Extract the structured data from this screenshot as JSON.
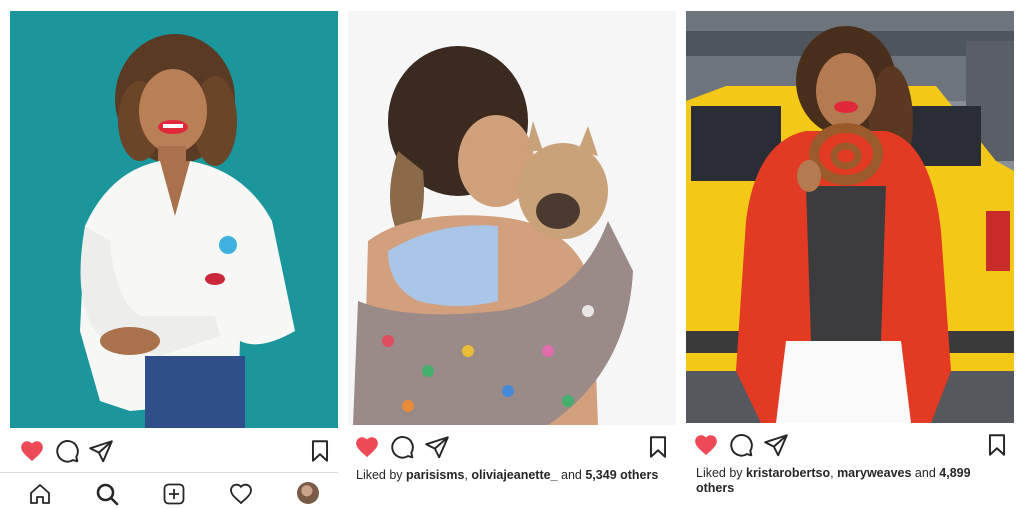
{
  "posts": [
    {
      "id_label": "left",
      "liked_by_label": "",
      "liked_users": [],
      "and_label": "",
      "count": "",
      "others_label": ""
    },
    {
      "id_label": "middle",
      "liked_by_label": "Liked by",
      "liked_users": [
        "parisisms",
        "oliviajeanette_"
      ],
      "and_label": "and",
      "count": "5,349",
      "others_label": "others"
    },
    {
      "id_label": "right",
      "liked_by_label": "Liked by",
      "liked_users": [
        "kristarobertso",
        "maryweaves"
      ],
      "and_label": "and",
      "count": "4,899",
      "others_label": "others"
    }
  ],
  "colors": {
    "like_red": "#ed4956",
    "icon_dark": "#262626",
    "teal_bg": "#1c9aa0",
    "coat_red": "#e23a23",
    "taxi_yellow": "#f4c816"
  },
  "icons": [
    "heart-icon",
    "comment-icon",
    "share-icon",
    "bookmark-icon",
    "home-icon",
    "search-icon",
    "add-icon",
    "activity-icon",
    "profile-avatar"
  ]
}
